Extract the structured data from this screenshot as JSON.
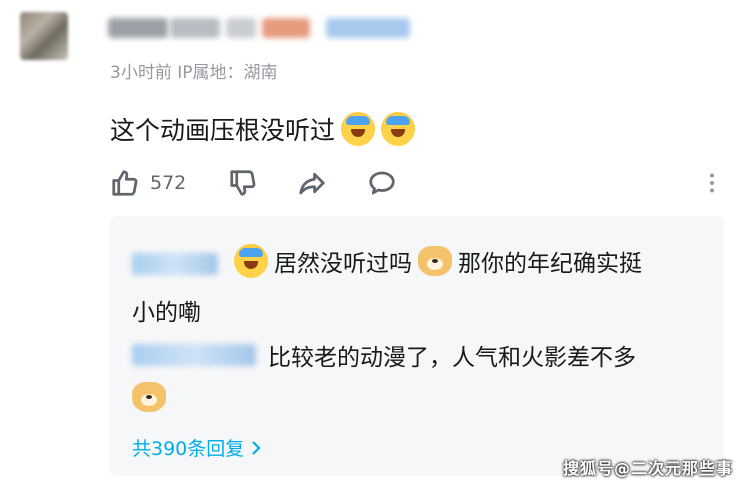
{
  "comment": {
    "meta": "3小时前 IP属地：湖南",
    "text": "这个动画压根没听过",
    "likes": "572"
  },
  "replies": [
    {
      "line1": "居然没听过吗",
      "line1_after": "那你的年纪确实挺",
      "line2": "小的嘞"
    },
    {
      "line1": "比较老的动漫了，人气和火影差不多"
    }
  ],
  "more_replies_label": "共390条回复",
  "watermark": "搜狐号@二次元那些事",
  "icons": {
    "like": "thumbs-up-icon",
    "dislike": "thumbs-down-icon",
    "share": "share-arrow-icon",
    "reply": "comment-bubble-icon",
    "more": "more-vertical-icon"
  },
  "colors": {
    "link": "#00aeec",
    "meta": "#9499a0",
    "reply_bg": "#f6f7f8"
  }
}
